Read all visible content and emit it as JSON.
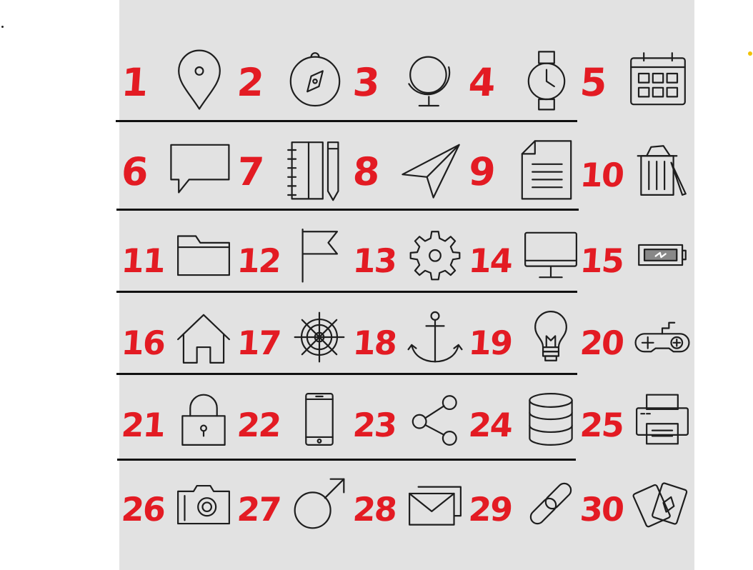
{
  "colors": {
    "sheet": "#e2e2e2",
    "number": "#e31b23",
    "line": "#111111",
    "icon": "#1e1e1e",
    "yellow_dot": "#f2c200"
  },
  "cells": [
    {
      "number": "1",
      "icon": "map-pin-icon"
    },
    {
      "number": "2",
      "icon": "compass-icon"
    },
    {
      "number": "3",
      "icon": "globe-icon"
    },
    {
      "number": "4",
      "icon": "wristwatch-icon"
    },
    {
      "number": "5",
      "icon": "calendar-icon"
    },
    {
      "number": "6",
      "icon": "chat-bubble-icon"
    },
    {
      "number": "7",
      "icon": "notebook-pen-icon"
    },
    {
      "number": "8",
      "icon": "paper-plane-icon"
    },
    {
      "number": "9",
      "icon": "document-icon"
    },
    {
      "number": "10",
      "icon": "trash-bin-icon"
    },
    {
      "number": "11",
      "icon": "folder-icon"
    },
    {
      "number": "12",
      "icon": "flag-icon"
    },
    {
      "number": "13",
      "icon": "gear-icon"
    },
    {
      "number": "14",
      "icon": "monitor-icon"
    },
    {
      "number": "15",
      "icon": "battery-icon"
    },
    {
      "number": "16",
      "icon": "home-icon"
    },
    {
      "number": "17",
      "icon": "ship-wheel-icon"
    },
    {
      "number": "18",
      "icon": "anchor-icon"
    },
    {
      "number": "19",
      "icon": "light-bulb-icon"
    },
    {
      "number": "20",
      "icon": "gamepad-icon"
    },
    {
      "number": "21",
      "icon": "padlock-icon"
    },
    {
      "number": "22",
      "icon": "smartphone-icon"
    },
    {
      "number": "23",
      "icon": "share-icon"
    },
    {
      "number": "24",
      "icon": "database-icon"
    },
    {
      "number": "25",
      "icon": "printer-icon"
    },
    {
      "number": "26",
      "icon": "camera-icon"
    },
    {
      "number": "27",
      "icon": "male-symbol-icon"
    },
    {
      "number": "28",
      "icon": "envelopes-icon"
    },
    {
      "number": "29",
      "icon": "chain-link-icon"
    },
    {
      "number": "30",
      "icon": "playing-cards-icon"
    }
  ]
}
